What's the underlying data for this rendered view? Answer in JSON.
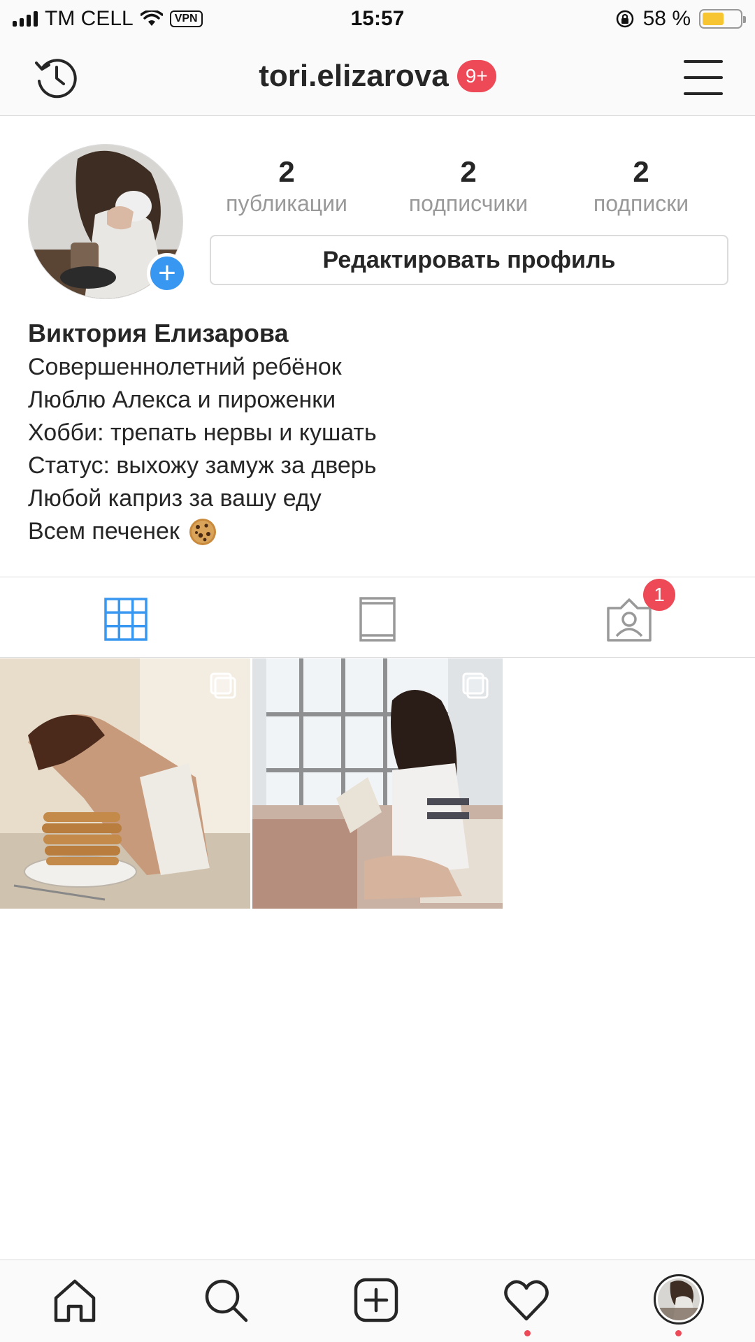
{
  "status_bar": {
    "carrier": "TM CELL",
    "vpn": "VPN",
    "time": "15:57",
    "battery": "58 %",
    "battery_level": 0.58
  },
  "header": {
    "username": "tori.elizarova",
    "notification_badge": "9+"
  },
  "stats": {
    "posts_count": "2",
    "posts_label": "публикации",
    "followers_count": "2",
    "followers_label": "подписчики",
    "following_count": "2",
    "following_label": "подписки"
  },
  "profile": {
    "edit_button": "Редактировать профиль",
    "add_story_symbol": "+",
    "full_name": "Виктория Елизарова",
    "bio_lines": [
      "Совершеннолетний ребёнок",
      "Люблю Алекса и пироженки",
      "Хобби: трепать нервы и кушать",
      "Статус: выхожу замуж за дверь",
      "Любой каприз за вашу еду",
      "Всем печенек"
    ],
    "bio_emoji": "cookie-emoji"
  },
  "tabs": {
    "items": [
      "grid-icon",
      "igtv-icon",
      "tagged-icon"
    ],
    "active": "grid-icon",
    "tagged_badge": "1"
  },
  "posts": [
    {
      "subject": "woman-face-in-pancakes",
      "multi": true
    },
    {
      "subject": "girl-reading-by-window",
      "multi": true
    }
  ],
  "bottom_nav": {
    "items": [
      "home-icon",
      "search-icon",
      "new-post-icon",
      "activity-heart-icon",
      "profile-avatar"
    ],
    "dots_under": [
      "activity-heart-icon",
      "profile-avatar"
    ]
  },
  "colors": {
    "accent_blue": "#3897f0",
    "badge_red": "#ed4956",
    "border": "#dbdbdb",
    "text": "#262626",
    "secondary_text": "#999999"
  }
}
